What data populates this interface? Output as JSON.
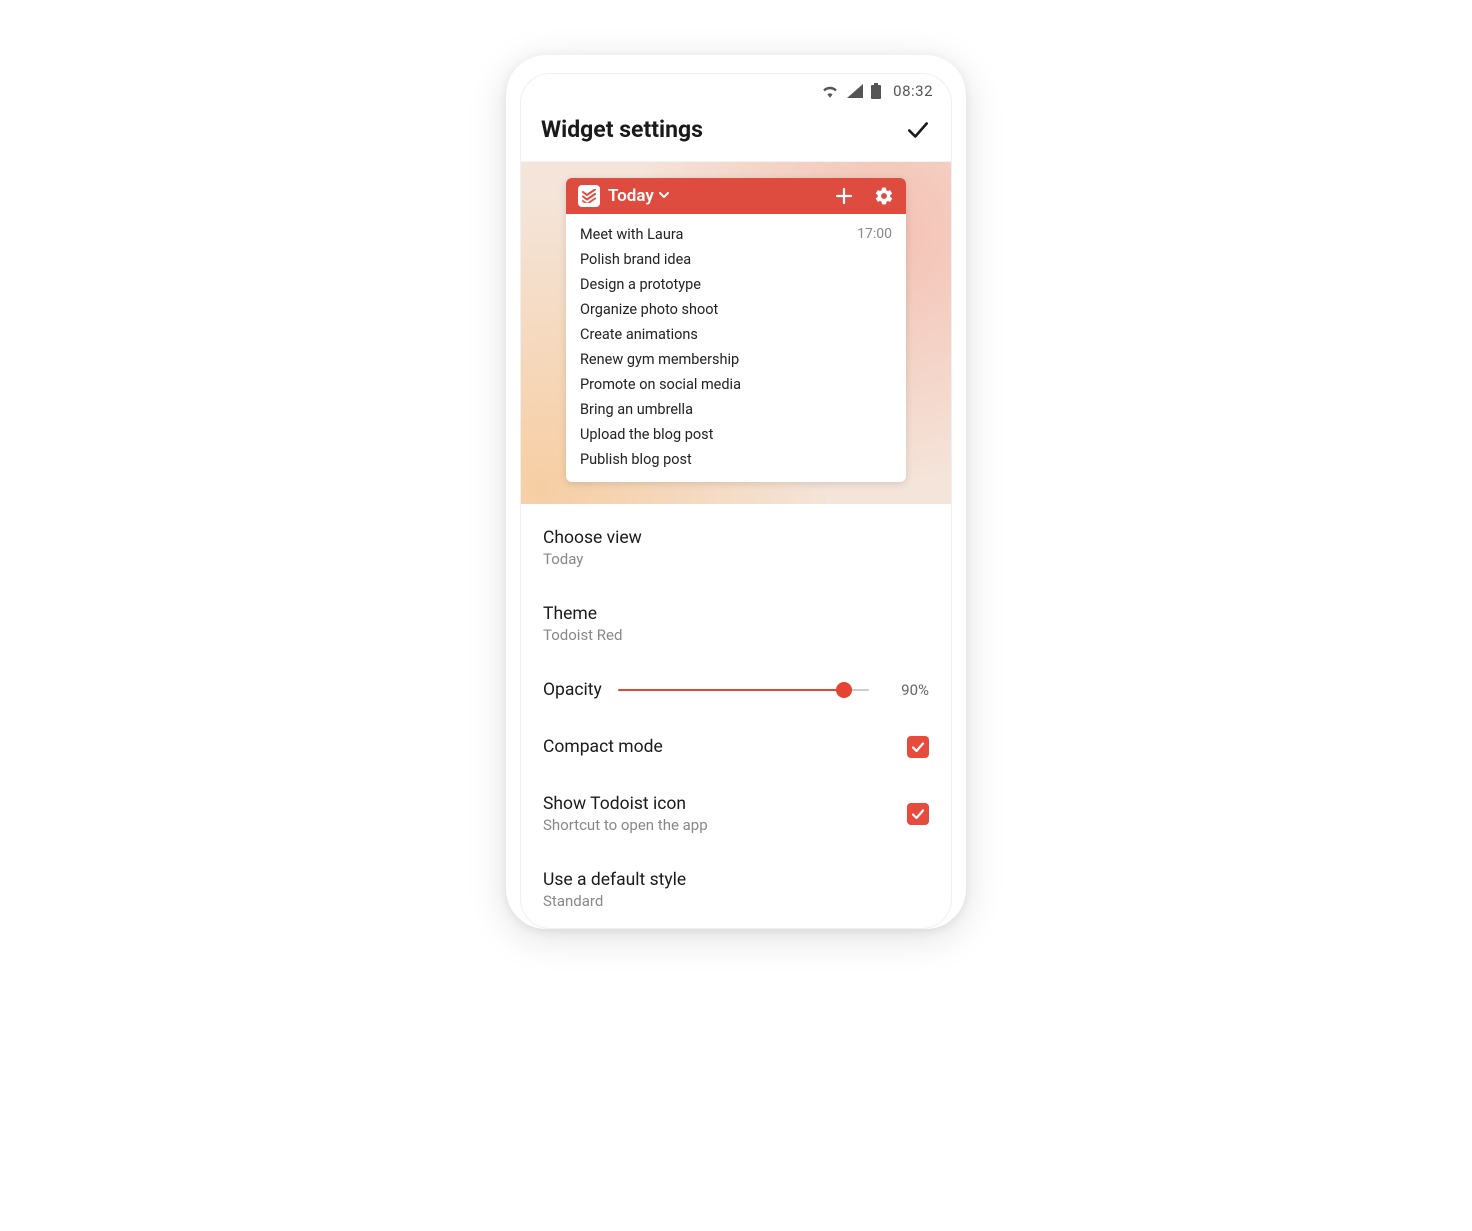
{
  "status": {
    "time": "08:32"
  },
  "header": {
    "title": "Widget settings"
  },
  "widget": {
    "view_label": "Today",
    "tasks": [
      {
        "title": "Meet with Laura",
        "time": "17:00"
      },
      {
        "title": "Polish brand idea",
        "time": ""
      },
      {
        "title": "Design a prototype",
        "time": ""
      },
      {
        "title": "Organize photo shoot",
        "time": ""
      },
      {
        "title": "Create animations",
        "time": ""
      },
      {
        "title": "Renew gym membership",
        "time": ""
      },
      {
        "title": "Promote on social media",
        "time": ""
      },
      {
        "title": "Bring an umbrella",
        "time": ""
      },
      {
        "title": "Upload the blog post",
        "time": ""
      },
      {
        "title": "Publish blog post",
        "time": ""
      }
    ]
  },
  "settings": {
    "choose_view": {
      "label": "Choose view",
      "value": "Today"
    },
    "theme": {
      "label": "Theme",
      "value": "Todoist Red"
    },
    "opacity": {
      "label": "Opacity",
      "value_pct": "90%",
      "percent": 90
    },
    "compact": {
      "label": "Compact mode",
      "checked": true
    },
    "show_icon": {
      "label": "Show Todoist icon",
      "sub": "Shortcut to open the app",
      "checked": true
    },
    "default_style": {
      "label": "Use a default style",
      "value": "Standard"
    }
  },
  "colors": {
    "accent": "#e54b3c"
  }
}
